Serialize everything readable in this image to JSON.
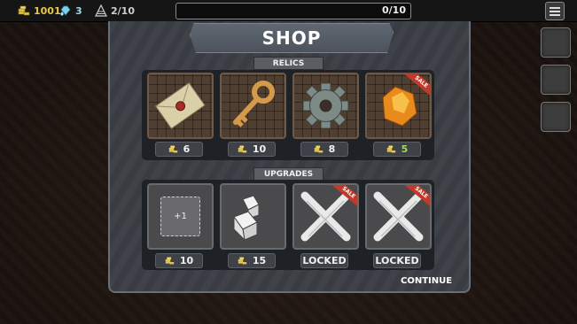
{
  "topbar": {
    "gold": "1001",
    "gems": "3",
    "floor": "2/10",
    "progress_text": "0/10",
    "progress_fraction": 0.0,
    "gold_icon": "coin-stack-icon",
    "gem_icon": "gem-icon",
    "floor_icon": "pyramid-icon",
    "menu_icon": "hamburger-menu-icon"
  },
  "shop": {
    "title": "SHOP",
    "relics_label": "RELICS",
    "upgrades_label": "UPGRADES",
    "continue_label": "CONTINUE",
    "sale_badge": "SALE",
    "relics": [
      {
        "icon": "sealed-envelope-icon",
        "price": "6",
        "sale": false
      },
      {
        "icon": "key-icon",
        "price": "10",
        "sale": false
      },
      {
        "icon": "gear-icon",
        "price": "8",
        "sale": false
      },
      {
        "icon": "amber-crystal-icon",
        "price": "5",
        "sale": true
      }
    ],
    "upgrades": [
      {
        "icon": "plus-slot-icon",
        "label": "+1",
        "price": "10",
        "sale": false
      },
      {
        "icon": "dice-icon",
        "price": "15",
        "sale": false
      },
      {
        "icon": "locked-x-icon",
        "price": "LOCKED",
        "sale": true
      },
      {
        "icon": "locked-x-icon",
        "price": "LOCKED",
        "sale": true
      }
    ]
  },
  "colors": {
    "gold": "#e8c84a",
    "sale_red": "#c0392b",
    "sale_price_green": "#9ddc5a"
  }
}
